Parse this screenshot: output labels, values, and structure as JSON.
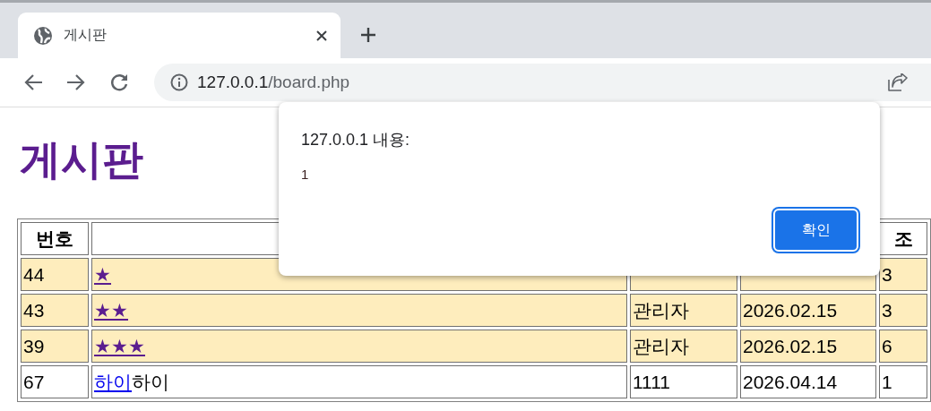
{
  "browser": {
    "tab": {
      "title": "게시판",
      "selected": true
    },
    "address": {
      "host": "127.0.0.1",
      "path": "/board.php"
    }
  },
  "page": {
    "heading": "게시판",
    "table": {
      "columns": [
        {
          "label": "번호"
        },
        {},
        {},
        {},
        {
          "label": "조"
        }
      ],
      "rows": [
        {
          "number": "44",
          "title": {
            "link": "★",
            "visited": true
          },
          "views": "3",
          "notice": true
        },
        {
          "number": "43",
          "title": {
            "link": "★★",
            "visited": true
          },
          "author": "관리자",
          "date": "2026.02.15",
          "views": "3",
          "notice": true
        },
        {
          "number": "39",
          "title": {
            "link": "★★★",
            "visited": true
          },
          "author": "관리자",
          "date": "2026.02.15",
          "views": "6",
          "notice": true
        },
        {
          "number": "67",
          "title": {
            "link": "하이",
            "visited": false,
            "rest": "하이"
          },
          "author": "1111",
          "date": "2026.04.14",
          "views": "1",
          "notice": false
        }
      ]
    }
  },
  "dialog": {
    "title": "127.0.0.1 내용:",
    "message": "1",
    "button": "확인"
  }
}
